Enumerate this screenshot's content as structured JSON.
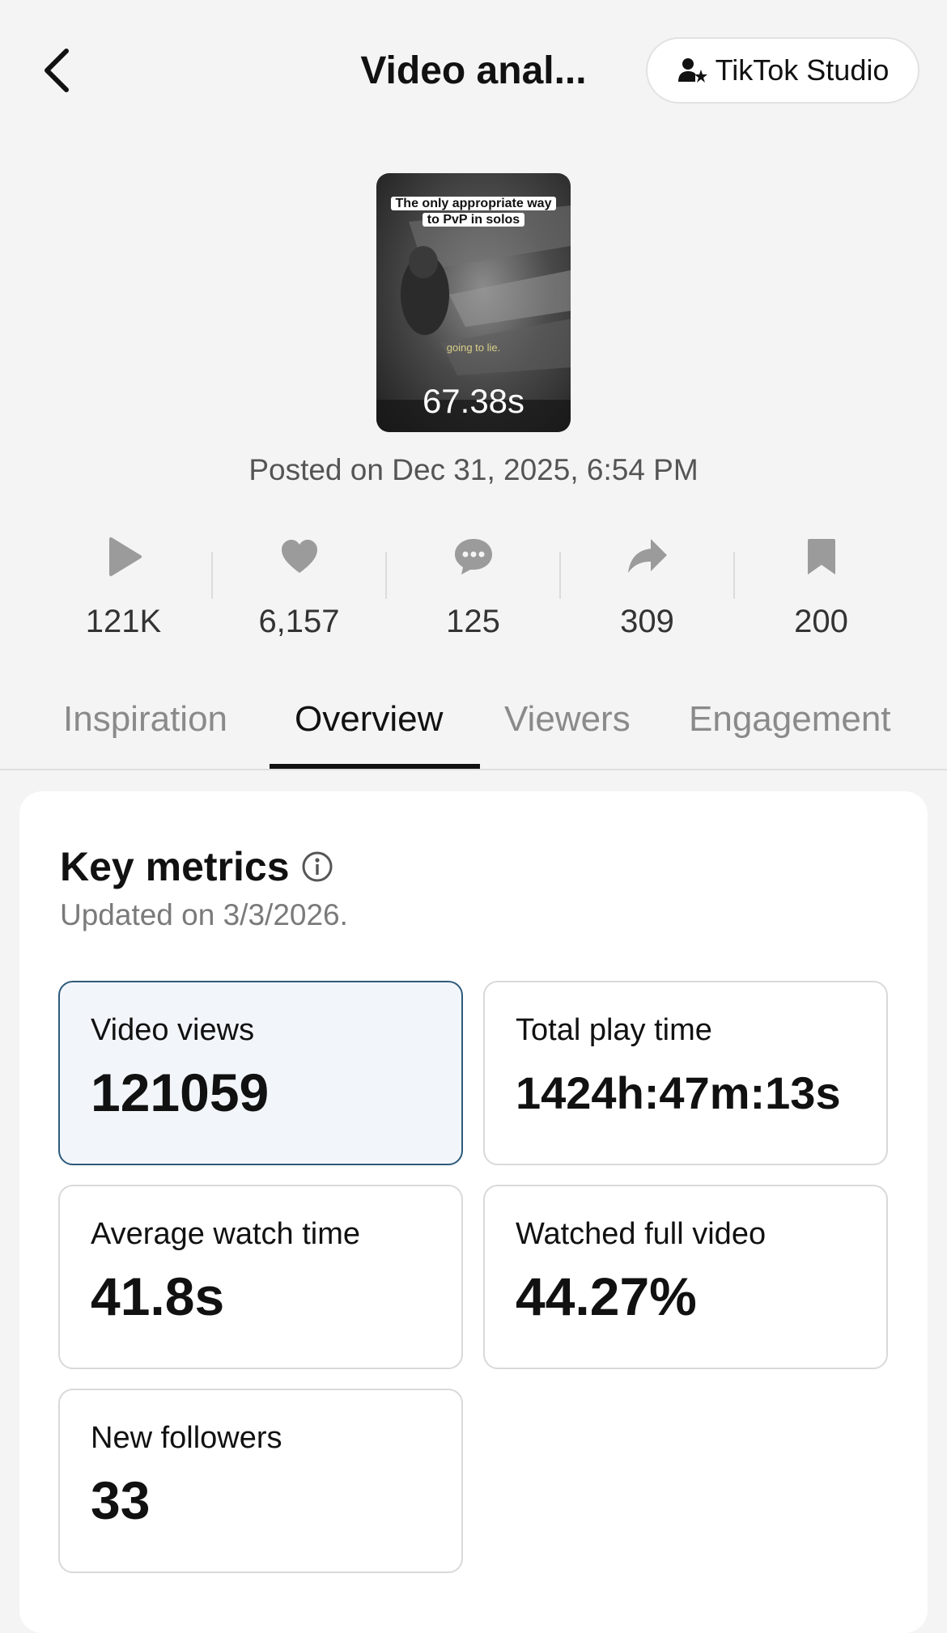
{
  "header": {
    "title": "Video anal...",
    "studio_label": "TikTok Studio"
  },
  "video": {
    "caption": "The only appropriate way to PvP in solos",
    "subtitle": "going to lie.",
    "duration": "67.38s",
    "posted": "Posted on Dec 31, 2025, 6:54 PM"
  },
  "stats": [
    {
      "icon": "play-icon",
      "value": "121K"
    },
    {
      "icon": "heart-icon",
      "value": "6,157"
    },
    {
      "icon": "comment-icon",
      "value": "125"
    },
    {
      "icon": "share-icon",
      "value": "309"
    },
    {
      "icon": "bookmark-icon",
      "value": "200"
    }
  ],
  "tabs": [
    {
      "label": "Inspiration",
      "active": false
    },
    {
      "label": "Overview",
      "active": true
    },
    {
      "label": "Viewers",
      "active": false
    },
    {
      "label": "Engagement",
      "active": false
    }
  ],
  "key_metrics": {
    "title": "Key metrics",
    "updated": "Updated on 3/3/2026.",
    "items": [
      {
        "label": "Video views",
        "value": "121059",
        "selected": true
      },
      {
        "label": "Total play time",
        "value": "1424h:47m:13s",
        "selected": false
      },
      {
        "label": "Average watch time",
        "value": "41.8s",
        "selected": false
      },
      {
        "label": "Watched full video",
        "value": "44.27%",
        "selected": false
      },
      {
        "label": "New followers",
        "value": "33",
        "selected": false
      }
    ]
  },
  "colors": {
    "background": "#f4f4f4",
    "selected_card_bg": "#f2f6fa",
    "selected_card_border": "#2d5a7b",
    "stat_icon": "#9b9b9b"
  }
}
